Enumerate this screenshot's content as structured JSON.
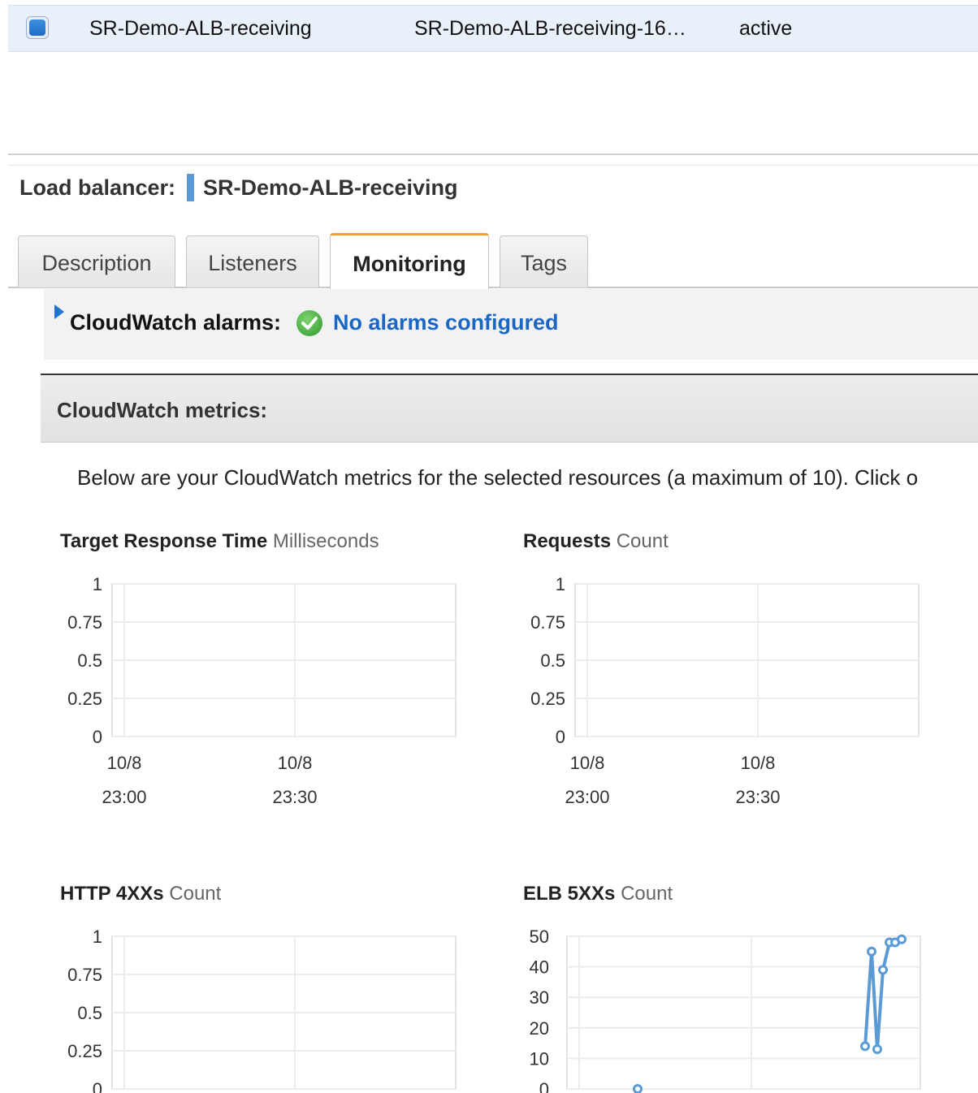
{
  "top_row": {
    "name": "SR-Demo-ALB-receiving",
    "dns": "SR-Demo-ALB-receiving-16…",
    "state": "active"
  },
  "load_balancer": {
    "label": "Load balancer:",
    "name": "SR-Demo-ALB-receiving"
  },
  "tabs": [
    {
      "label": "Description",
      "active": false
    },
    {
      "label": "Listeners",
      "active": false
    },
    {
      "label": "Monitoring",
      "active": true
    },
    {
      "label": "Tags",
      "active": false
    }
  ],
  "alarms": {
    "label": "CloudWatch alarms:",
    "status": "No alarms configured"
  },
  "metrics": {
    "title": "CloudWatch metrics:",
    "description": "Below are your CloudWatch metrics for the selected resources (a maximum of 10). Click o"
  },
  "icons": {
    "expand": "triangle-right-icon",
    "ok": "check-circle-icon",
    "select": "checkbox-checked-icon"
  },
  "colors": {
    "accent_tab": "#f0a030",
    "link": "#1a66c2",
    "series": "#5b9bd5",
    "ok_green": "#2e9a2e"
  },
  "chart_data": [
    {
      "type": "line",
      "title": "Target Response Time",
      "unit": "Milliseconds",
      "y_ticks": [
        "1",
        "0.75",
        "0.5",
        "0.25",
        "0"
      ],
      "ylim": [
        0,
        1
      ],
      "x_ticks": [
        [
          "10/8",
          "23:00"
        ],
        [
          "10/8",
          "23:30"
        ]
      ],
      "series": []
    },
    {
      "type": "line",
      "title": "Requests",
      "unit": "Count",
      "y_ticks": [
        "1",
        "0.75",
        "0.5",
        "0.25",
        "0"
      ],
      "ylim": [
        0,
        1
      ],
      "x_ticks": [
        [
          "10/8",
          "23:00"
        ],
        [
          "10/8",
          "23:30"
        ]
      ],
      "series": []
    },
    {
      "type": "line",
      "title": "HTTP 4XXs",
      "unit": "Count",
      "y_ticks": [
        "1",
        "0.75",
        "0.5",
        "0.25",
        "0"
      ],
      "ylim": [
        0,
        1
      ],
      "x_ticks": [],
      "series": []
    },
    {
      "type": "line",
      "title": "ELB 5XXs",
      "unit": "Count",
      "y_ticks": [
        "50",
        "40",
        "30",
        "20",
        "10",
        "0"
      ],
      "ylim": [
        0,
        50
      ],
      "x_ticks": [],
      "series": [
        {
          "values": [
            0,
            14,
            45,
            13,
            39,
            48,
            48,
            49
          ]
        }
      ]
    }
  ]
}
